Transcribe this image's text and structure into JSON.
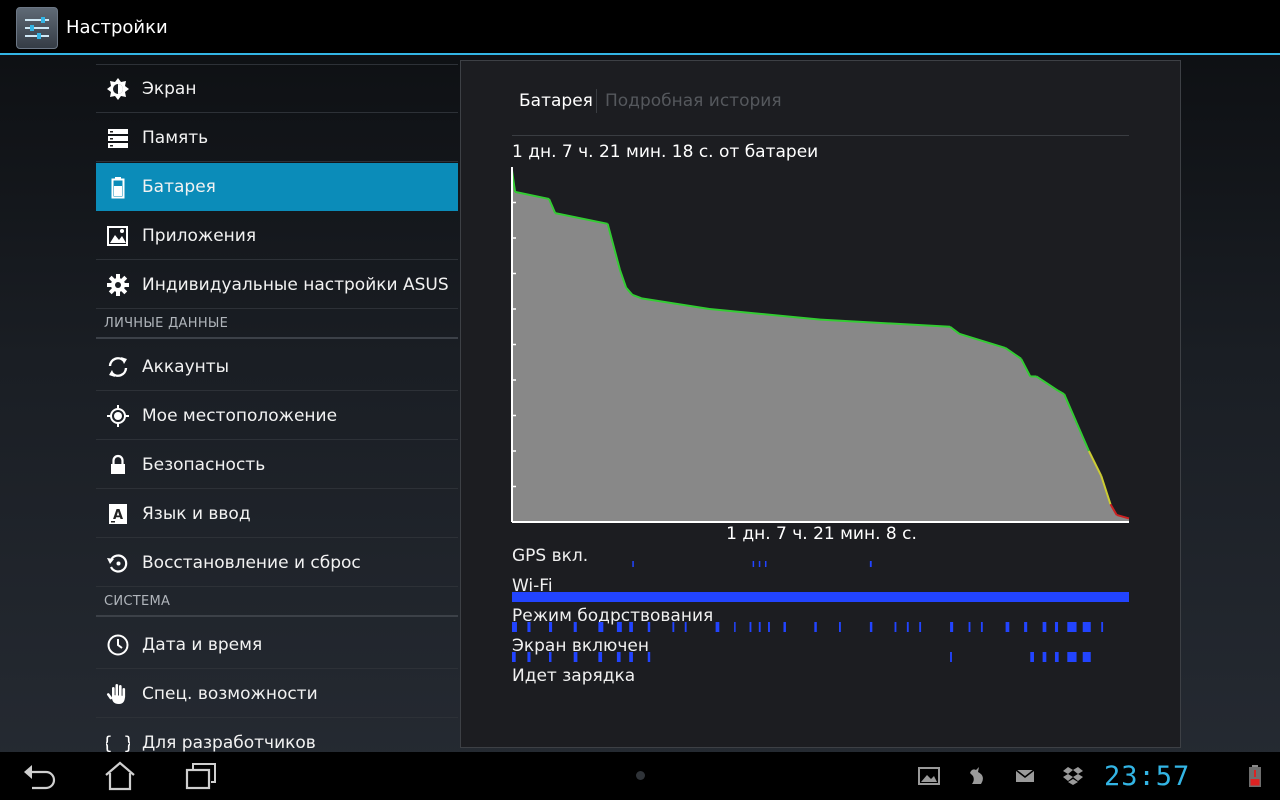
{
  "app": {
    "title": "Настройки"
  },
  "sidebar": {
    "items": [
      {
        "label": "Экран",
        "icon": "brightness-icon"
      },
      {
        "label": "Память",
        "icon": "storage-icon"
      },
      {
        "label": "Батарея",
        "icon": "battery-icon",
        "selected": true
      },
      {
        "label": "Приложения",
        "icon": "apps-icon"
      },
      {
        "label": "Индивидуальные настройки ASUS",
        "icon": "gear-icon"
      },
      {
        "label": "Аккаунты",
        "icon": "sync-icon"
      },
      {
        "label": "Мое местоположение",
        "icon": "location-icon"
      },
      {
        "label": "Безопасность",
        "icon": "lock-icon"
      },
      {
        "label": "Язык и ввод",
        "icon": "language-icon"
      },
      {
        "label": "Восстановление и сброс",
        "icon": "backup-icon"
      },
      {
        "label": "Дата и время",
        "icon": "clock-icon"
      },
      {
        "label": "Спец. возможности",
        "icon": "hand-icon"
      },
      {
        "label": "Для разработчиков",
        "icon": "braces-icon"
      }
    ],
    "headers": [
      "ЛИЧНЫЕ ДАННЫЕ",
      "СИСТЕМА"
    ]
  },
  "battery": {
    "tabs": [
      "Батарея",
      "Подробная история"
    ],
    "on_battery_label": "1 дн. 7 ч. 21 мин. 18 с. от батареи",
    "duration_label": "1 дн. 7 ч. 21 мин. 8 с.",
    "signals": [
      "GPS вкл.",
      "Wi-Fi",
      "Режим бодрствования",
      "Экран включен",
      "Идет зарядка"
    ]
  },
  "chart_data": {
    "type": "area",
    "title": "",
    "xlabel": "1 дн. 7 ч. 21 мин. 8 с.",
    "ylabel": "",
    "x_unit": "fraction of elapsed time",
    "ylim": [
      0,
      100
    ],
    "grid": false,
    "series": [
      {
        "x": [
          0,
          0.005,
          0.06,
          0.07,
          0.155,
          0.175,
          0.185,
          0.195,
          0.21,
          0.32,
          0.5,
          0.71,
          0.725,
          0.8,
          0.825,
          0.84,
          0.85,
          0.885,
          0.895,
          0.915,
          0.935,
          0.955,
          0.97,
          0.98,
          1.0
        ],
        "y": [
          99,
          93,
          91,
          87,
          84,
          71,
          66,
          64,
          63,
          60,
          57,
          55,
          53,
          49,
          46,
          41,
          41,
          37,
          36,
          28,
          20,
          13,
          5,
          2,
          1
        ]
      }
    ],
    "level_colors": {
      "high": "#33cc33",
      "medium": "#cccc33",
      "low": "#cc2222"
    },
    "fill_color": "#888888",
    "signals": {
      "gps": [
        [
          0.195,
          0.197
        ],
        [
          0.39,
          0.392
        ],
        [
          0.4,
          0.402
        ],
        [
          0.41,
          0.412
        ],
        [
          0.58,
          0.583
        ]
      ],
      "wifi": [
        [
          0,
          1
        ]
      ],
      "awake": [
        [
          0,
          0.008
        ],
        [
          0.025,
          0.03
        ],
        [
          0.06,
          0.065
        ],
        [
          0.1,
          0.105
        ],
        [
          0.14,
          0.148
        ],
        [
          0.17,
          0.178
        ],
        [
          0.19,
          0.196
        ],
        [
          0.22,
          0.224
        ],
        [
          0.26,
          0.263
        ],
        [
          0.28,
          0.283
        ],
        [
          0.33,
          0.336
        ],
        [
          0.36,
          0.362
        ],
        [
          0.385,
          0.388
        ],
        [
          0.4,
          0.403
        ],
        [
          0.415,
          0.418
        ],
        [
          0.44,
          0.444
        ],
        [
          0.49,
          0.494
        ],
        [
          0.53,
          0.533
        ],
        [
          0.58,
          0.584
        ],
        [
          0.62,
          0.623
        ],
        [
          0.64,
          0.643
        ],
        [
          0.66,
          0.663
        ],
        [
          0.71,
          0.715
        ],
        [
          0.74,
          0.743
        ],
        [
          0.76,
          0.763
        ],
        [
          0.8,
          0.806
        ],
        [
          0.83,
          0.835
        ],
        [
          0.86,
          0.866
        ],
        [
          0.88,
          0.885
        ],
        [
          0.9,
          0.915
        ],
        [
          0.925,
          0.938
        ],
        [
          0.955,
          0.958
        ]
      ],
      "screen": [
        [
          0,
          0.006
        ],
        [
          0.025,
          0.03
        ],
        [
          0.06,
          0.064
        ],
        [
          0.1,
          0.106
        ],
        [
          0.14,
          0.146
        ],
        [
          0.17,
          0.176
        ],
        [
          0.19,
          0.196
        ],
        [
          0.22,
          0.224
        ],
        [
          0.71,
          0.713
        ],
        [
          0.84,
          0.846
        ],
        [
          0.86,
          0.866
        ],
        [
          0.88,
          0.886
        ],
        [
          0.9,
          0.915
        ],
        [
          0.925,
          0.938
        ]
      ],
      "charging": []
    }
  },
  "statusbar": {
    "clock": "23:57",
    "icons": [
      "gallery-icon",
      "bird-icon",
      "mail-icon",
      "dropbox-icon",
      "wifi-icon",
      "battery-low-icon"
    ]
  },
  "nav": {
    "buttons": [
      "back-icon",
      "home-icon",
      "recent-apps-icon"
    ]
  },
  "colors": {
    "accent": "#33b5e5",
    "selected": "#0b8cb9",
    "signal": "#2244ff"
  }
}
